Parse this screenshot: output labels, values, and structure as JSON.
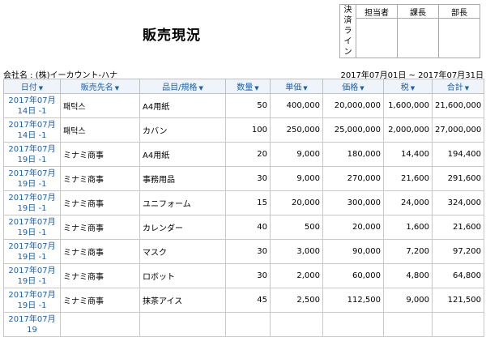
{
  "title": "販売現況",
  "approval": {
    "vertical_label": [
      "決",
      "済",
      "ラ",
      "イ",
      "ン"
    ],
    "roles": [
      "担当者",
      "課長",
      "部長"
    ]
  },
  "company_line": "会社名 : (株)イーカウント-ハナ",
  "period": "2017年07月01日 ~ 2017年07月31日",
  "columns": [
    "日付",
    "販売先名",
    "品目/規格",
    "数量",
    "単価",
    "価格",
    "税",
    "合計"
  ],
  "rows": [
    {
      "date": "2017年07月14日 -1",
      "customer": "패턱스",
      "item": "A4用紙",
      "qty": "50",
      "unit_price": "400,000",
      "price": "20,000,000",
      "tax": "1,600,000",
      "total": "21,600,000"
    },
    {
      "date": "2017年07月14日 -1",
      "customer": "패턱스",
      "item": "カバン",
      "qty": "100",
      "unit_price": "250,000",
      "price": "25,000,000",
      "tax": "2,000,000",
      "total": "27,000,000"
    },
    {
      "date": "2017年07月19日 -1",
      "customer": "ミナミ商事",
      "item": "A4用紙",
      "qty": "20",
      "unit_price": "9,000",
      "price": "180,000",
      "tax": "14,400",
      "total": "194,400"
    },
    {
      "date": "2017年07月19日 -1",
      "customer": "ミナミ商事",
      "item": "事務用品",
      "qty": "30",
      "unit_price": "9,000",
      "price": "270,000",
      "tax": "21,600",
      "total": "291,600"
    },
    {
      "date": "2017年07月19日 -1",
      "customer": "ミナミ商事",
      "item": "ユニフォーム",
      "qty": "15",
      "unit_price": "20,000",
      "price": "300,000",
      "tax": "24,000",
      "total": "324,000"
    },
    {
      "date": "2017年07月19日 -1",
      "customer": "ミナミ商事",
      "item": "カレンダー",
      "qty": "40",
      "unit_price": "500",
      "price": "20,000",
      "tax": "1,600",
      "total": "21,600"
    },
    {
      "date": "2017年07月19日 -1",
      "customer": "ミナミ商事",
      "item": "マスク",
      "qty": "30",
      "unit_price": "3,000",
      "price": "90,000",
      "tax": "7,200",
      "total": "97,200"
    },
    {
      "date": "2017年07月19日 -1",
      "customer": "ミナミ商事",
      "item": "ロボット",
      "qty": "30",
      "unit_price": "2,000",
      "price": "60,000",
      "tax": "4,800",
      "total": "64,800"
    },
    {
      "date": "2017年07月19日 -1",
      "customer": "ミナミ商事",
      "item": "抹茶アイス",
      "qty": "45",
      "unit_price": "2,500",
      "price": "112,500",
      "tax": "9,000",
      "total": "121,500"
    },
    {
      "date": "2017年07月19",
      "customer": "",
      "item": "",
      "qty": "",
      "unit_price": "",
      "price": "",
      "tax": "",
      "total": ""
    }
  ],
  "colors": {
    "header_bg": "#eef4fa",
    "link": "#1a60b0",
    "border": "#c0c0c0"
  }
}
